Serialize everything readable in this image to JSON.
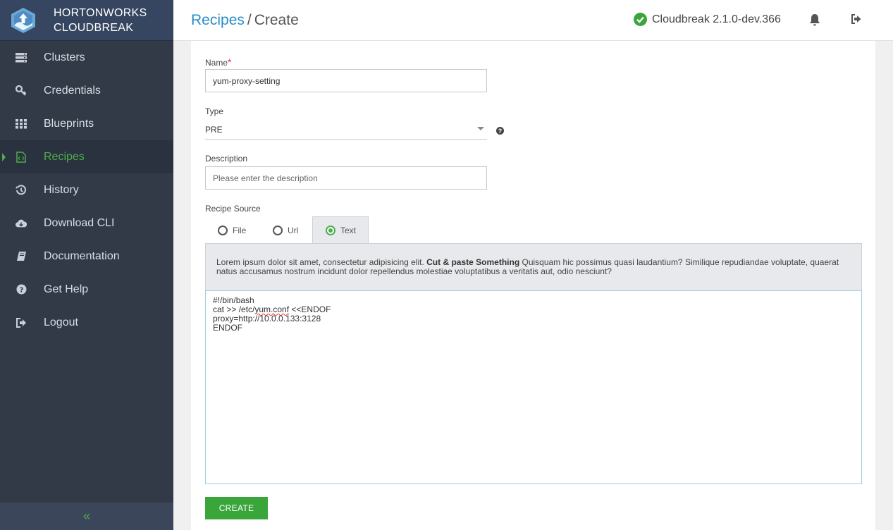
{
  "brand": {
    "line1": "HORTONWORKS",
    "line2": "CLOUDBREAK"
  },
  "sidebar": {
    "items": [
      {
        "label": "Clusters",
        "icon": "server-icon"
      },
      {
        "label": "Credentials",
        "icon": "key-icon"
      },
      {
        "label": "Blueprints",
        "icon": "grid-icon"
      },
      {
        "label": "Recipes",
        "icon": "file-code-icon",
        "active": true
      },
      {
        "label": "History",
        "icon": "history-icon"
      },
      {
        "label": "Download CLI",
        "icon": "cloud-download-icon"
      },
      {
        "label": "Documentation",
        "icon": "book-icon"
      },
      {
        "label": "Get Help",
        "icon": "question-circle-icon"
      },
      {
        "label": "Logout",
        "icon": "sign-out-icon"
      }
    ],
    "collapse_label": "«"
  },
  "header": {
    "breadcrumb_link": "Recipes",
    "breadcrumb_sep": "/",
    "breadcrumb_current": "Create",
    "version": "Cloudbreak 2.1.0-dev.366"
  },
  "form": {
    "name_label": "Name",
    "name_required": "*",
    "name_value": "yum-proxy-setting",
    "type_label": "Type",
    "type_value": "PRE",
    "help_glyph": "?",
    "description_label": "Description",
    "description_placeholder": "Please enter the description",
    "source_label": "Recipe Source",
    "source_options": [
      "File",
      "Url",
      "Text"
    ],
    "source_selected": "Text",
    "info_text_1": "Lorem ipsum dolor sit amet, consectetur adipisicing elit. ",
    "info_text_bold": "Cut & paste Something",
    "info_text_2": " Quisquam hic possimus quasi laudantium? Similique repudiandae voluptate, quaerat natus accusamus nostrum incidunt dolor repellendus molestiae voluptatibus a veritatis aut, odio nesciunt?",
    "code_line1": "#!/bin/bash",
    "code_line2a": "cat >> /etc/",
    "code_line2b": "yum.conf",
    "code_line2c": " <<ENDOF",
    "code_line3": "proxy=http://10.0.0.133:3128",
    "code_line4": "ENDOF",
    "create_label": "CREATE"
  },
  "colors": {
    "accent_green": "#4cae4c",
    "link_blue": "#2a8ec9",
    "sidebar_bg": "#323a48"
  }
}
